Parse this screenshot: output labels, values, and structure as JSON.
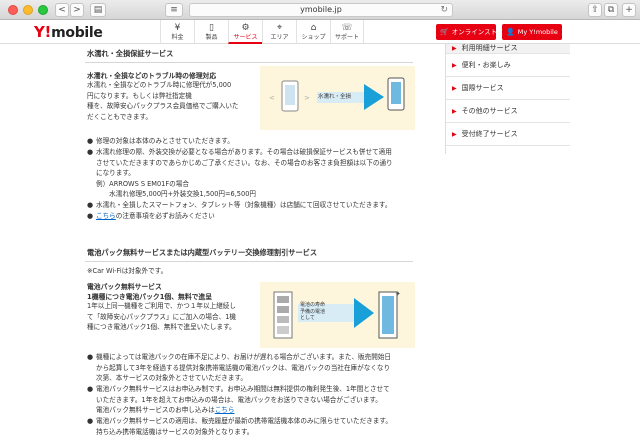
{
  "browser": {
    "url": "ymobile.jp",
    "back_label": "<",
    "forward_label": ">",
    "reload_label": "↻"
  },
  "header": {
    "logo": {
      "y": "Y!",
      "text": "mobile"
    },
    "nav": [
      {
        "icon": "¥",
        "label": "料金"
      },
      {
        "icon": "▯",
        "label": "製品"
      },
      {
        "icon": "⚙",
        "label": "サービス"
      },
      {
        "icon": "⌖",
        "label": "エリア"
      },
      {
        "icon": "⌂",
        "label": "ショップ"
      },
      {
        "icon": "☏",
        "label": "サポート"
      }
    ],
    "online_store": "オンラインストア",
    "my_ymobile": "My Y!mobile",
    "accent": "#e60012"
  },
  "side": {
    "items": [
      "利用明細サービス",
      "便利・お楽しみ",
      "国際サービス",
      "その他のサービス",
      "受付終了サービス"
    ]
  },
  "sec1": {
    "title": "水濡れ・全損保証サービス",
    "sub": "水濡れ・全損などのトラブル時の修理対応",
    "desc": [
      "水濡れ・全損などのトラブル時に修理代が5,000",
      "円になります。もしくは弊社指定機",
      "種を、故障安心パックプラス会員価格でご購入いた",
      "だくこともできます。"
    ],
    "illus_label": "水濡れ・全損",
    "bullets": [
      {
        "text": "修理の対象は本体のみとさせていただきます。",
        "cont": []
      },
      {
        "text": "水濡れ修理の際、外装交換が必要となる場合があります。その場合は破損保証サービスも併せて適用",
        "cont": [
          "させていただきますのであらかじめご了承ください。なお、その場合のお客さま負担額は以下の通り",
          "になります。",
          "例）ARROWS S EM01Fの場合",
          "　　水濡れ修理5,000円+外装交換1,500円=6,500円"
        ]
      },
      {
        "text": "水濡れ・全損したスマートフォン、タブレット等（対象機種）は店舗にて回収させていただきます。",
        "cont": []
      }
    ],
    "notes_link": "こちら",
    "notes_rest": "の注意事項を必ずお読みください"
  },
  "sec2": {
    "title": "電池パック無料サービスまたは内蔵型バッテリー交換修理割引サービス",
    "note": "※Car Wi-Fiは対象外です。",
    "sub1": "電池パック無料サービス",
    "sub2": "1機種につき電池パック1個、無料で進呈",
    "desc": [
      "1年以上同一機種をご利用で、かつ１年以上継続し",
      "て「故障安心パックプラス」にご加入の場合、1機",
      "種につき電池パック1個、無料で進呈いたします。"
    ],
    "illus_label1": "電池の寿命",
    "illus_label2": "予備の電池",
    "illus_label3": "として",
    "bullets": [
      {
        "text": "機種によっては電池パックの在庫不足により、お届けが遅れる場合がございます。また、販売開始日",
        "cont": [
          "から起算して3年を経過する提供対象携帯電話機の電池パックは、電池パックの当社在庫がなくなり",
          "次第、本サービスの対象外とさせていただきます。"
        ]
      },
      {
        "text": "電池パック無料サービスはお申込み制です。お申込み期間は無料提供の権利発生後、1年間とさせて",
        "cont": [
          "いただきます。1年を超えてお申込みの場合は、電池パックをお送りできない場合がございます。",
          "電池パック無料サービスのお申し込みは"
        ],
        "link": "こちら"
      },
      {
        "text": "電池パック無料サービスの適用は、販売履歴が最新の携帯電話機本体のみに限らせていただきます。",
        "cont": [
          "持ち込み携帯電話機はサービスの対象外となります。"
        ]
      }
    ]
  }
}
